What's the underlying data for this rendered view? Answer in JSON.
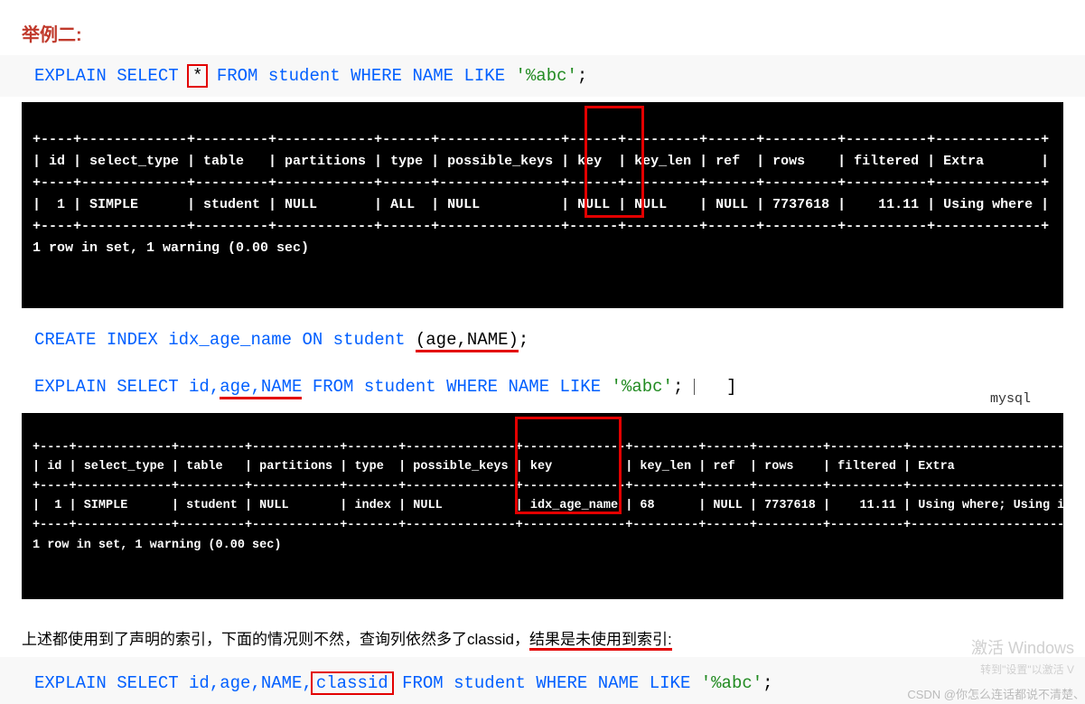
{
  "heading": "举例二:",
  "sql1": {
    "prefix": "EXPLAIN SELECT ",
    "boxed": "*",
    "mid": " FROM student WHERE NAME LIKE ",
    "str": "'%abc'",
    "suffix": ";"
  },
  "term1": {
    "sep": "+----+-------------+---------+------------+------+---------------+------+---------+------+---------+----------+-------------+",
    "header": "| id | select_type | table   | partitions | type | possible_keys | key  | key_len | ref  | rows    | filtered | Extra       |",
    "row": "|  1 | SIMPLE      | student | NULL       | ALL  | NULL          | NULL | NULL    | NULL | 7737618 |    11.11 | Using where |",
    "footer": "1 row in set, 1 warning (0.00 sec)"
  },
  "sql2": {
    "prefix": "CREATE INDEX idx_age_name ON student ",
    "u": "(age,NAME)",
    "suffix": ";"
  },
  "sql3": {
    "prefix": "EXPLAIN SELECT id,",
    "u": "age,NAME",
    "mid": " FROM student WHERE NAME LIKE ",
    "str": "'%abc'",
    "suffix": ";"
  },
  "tag": "mysql",
  "term2": {
    "sep": "+----+-------------+---------+------------+-------+---------------+--------------+---------+------+---------+----------+--------------------------+",
    "header": "| id | select_type | table   | partitions | type  | possible_keys | key          | key_len | ref  | rows    | filtered | Extra                    |",
    "row": "|  1 | SIMPLE      | student | NULL       | index | NULL          | idx_age_name | 68      | NULL | 7737618 |    11.11 | Using where; Using index |",
    "footer": "1 row in set, 1 warning (0.00 sec)"
  },
  "paragraph": {
    "p1": "上述都使用到了声明的索引，下面的情况则不然，查询列依然多了classid，",
    "p2": "结果是未使用到索引:"
  },
  "sql4": {
    "prefix": "EXPLAIN SELECT id,age,NAME,",
    "boxed": "classid",
    "mid": " FROM student WHERE NAME LIKE ",
    "str": "'%abc'",
    "suffix": ";"
  },
  "wm": {
    "l1": "激活 Windows",
    "l2": "转到\"设置\"以激活 V",
    "csdn": "CSDN @你怎么连话都说不清楚、"
  }
}
